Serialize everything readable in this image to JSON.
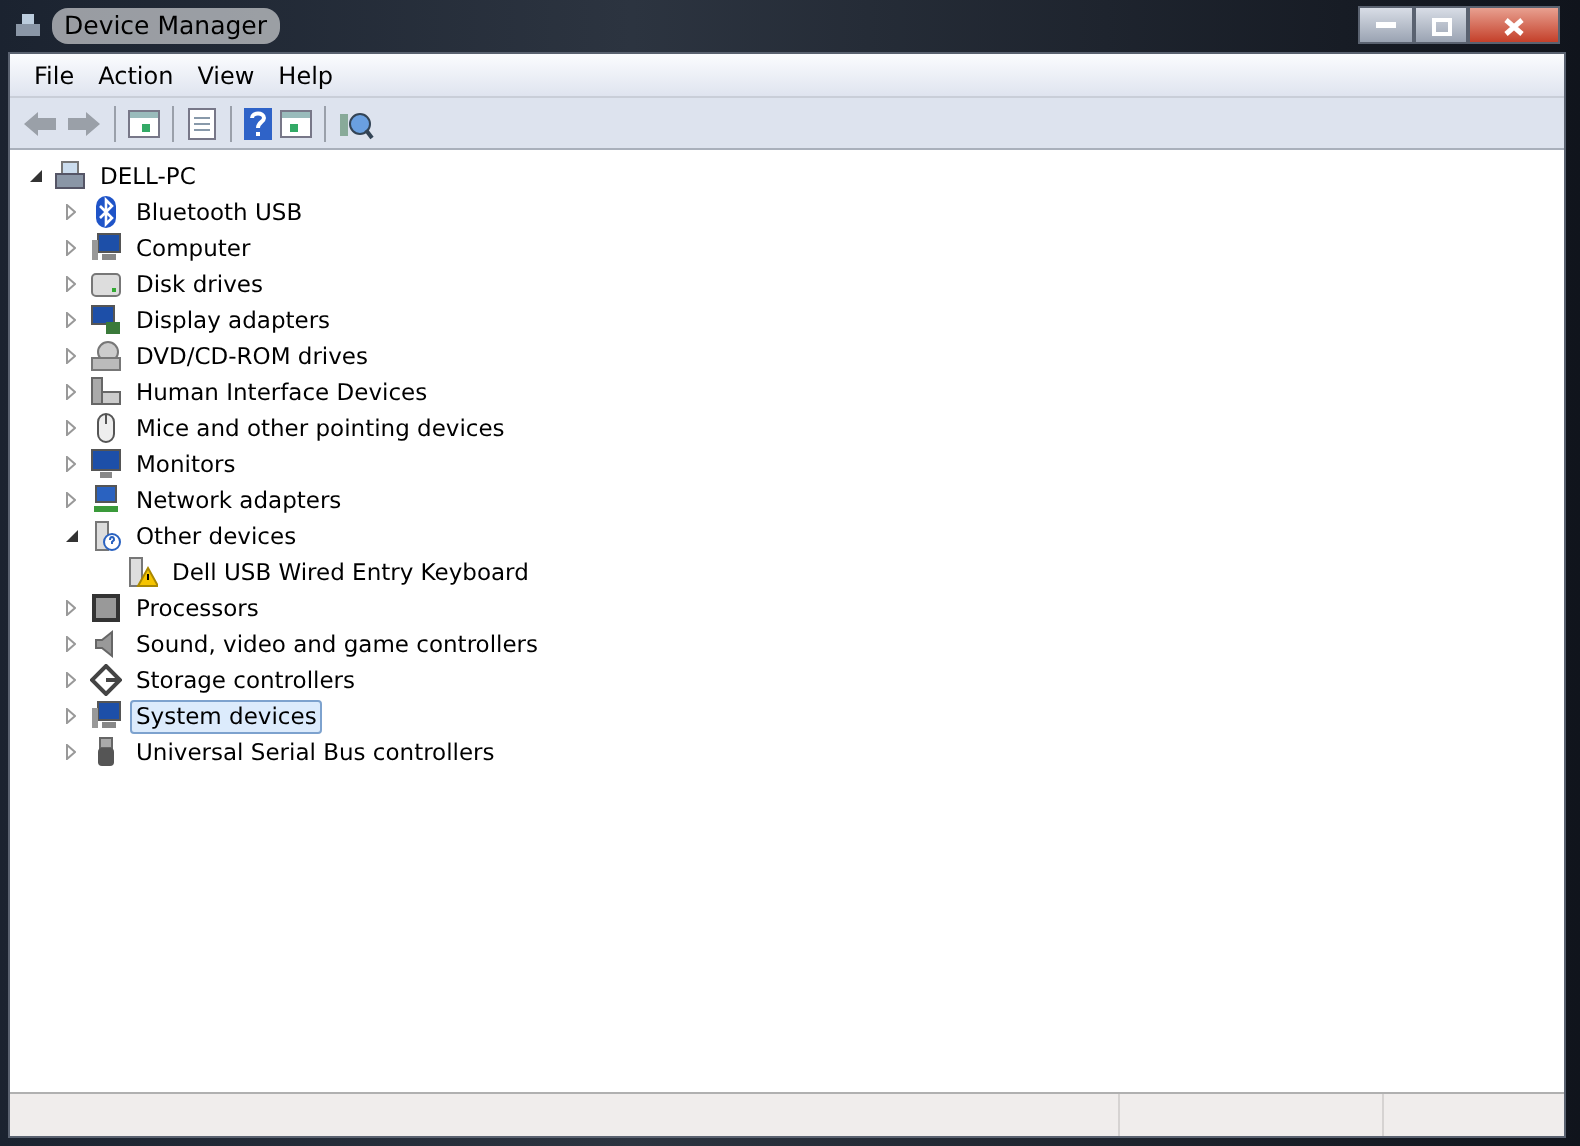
{
  "window": {
    "title": "Device Manager"
  },
  "menu": [
    "File",
    "Action",
    "View",
    "Help"
  ],
  "tree": {
    "label": "DELL-PC",
    "expanded": true,
    "selected": false,
    "children": [
      {
        "label": "Bluetooth USB",
        "expanded": false,
        "selected": false
      },
      {
        "label": "Computer",
        "expanded": false,
        "selected": false
      },
      {
        "label": "Disk drives",
        "expanded": false,
        "selected": false
      },
      {
        "label": "Display adapters",
        "expanded": false,
        "selected": false
      },
      {
        "label": "DVD/CD-ROM drives",
        "expanded": false,
        "selected": false
      },
      {
        "label": "Human Interface Devices",
        "expanded": false,
        "selected": false
      },
      {
        "label": "Mice and other pointing devices",
        "expanded": false,
        "selected": false
      },
      {
        "label": "Monitors",
        "expanded": false,
        "selected": false
      },
      {
        "label": "Network adapters",
        "expanded": false,
        "selected": false
      },
      {
        "label": "Other devices",
        "expanded": true,
        "selected": false,
        "children": [
          {
            "label": "Dell USB Wired Entry Keyboard",
            "selected": false
          }
        ]
      },
      {
        "label": "Processors",
        "expanded": false,
        "selected": false
      },
      {
        "label": "Sound, video and game controllers",
        "expanded": false,
        "selected": false
      },
      {
        "label": "Storage controllers",
        "expanded": false,
        "selected": false
      },
      {
        "label": "System devices",
        "expanded": false,
        "selected": true
      },
      {
        "label": "Universal Serial Bus controllers",
        "expanded": false,
        "selected": false
      }
    ]
  }
}
